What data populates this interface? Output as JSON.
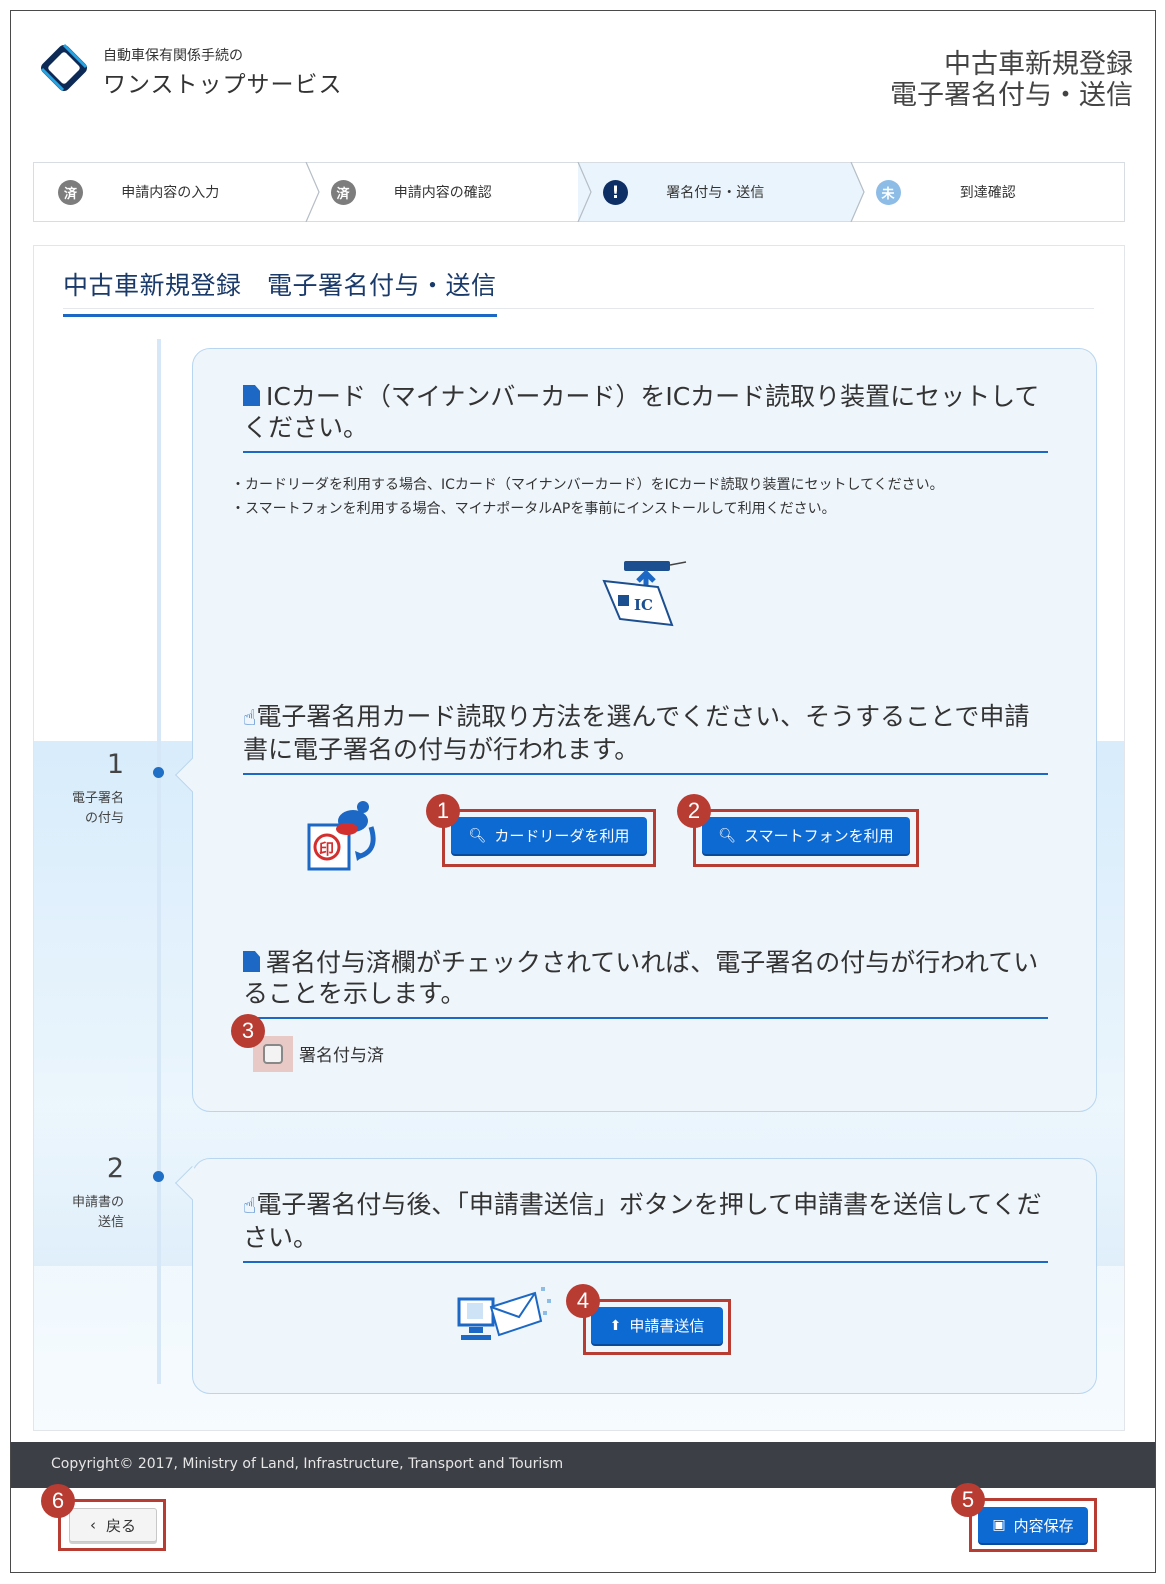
{
  "header": {
    "service_small": "自動車保有関係手続の",
    "service_big": "ワンストップサービス",
    "title_line1": "中古車新規登録",
    "title_line2": "電子署名付与・送信"
  },
  "steps": [
    {
      "icon": "済",
      "label": "申請内容の入力",
      "status": "done"
    },
    {
      "icon": "済",
      "label": "申請内容の確認",
      "status": "done"
    },
    {
      "icon": "!",
      "label": "署名付与・送信",
      "status": "current"
    },
    {
      "icon": "未",
      "label": "到達確認",
      "status": "todo"
    }
  ],
  "page_title": "中古車新規登録　電子署名付与・送信",
  "timeline": [
    {
      "num": "1",
      "sub1": "電子署名",
      "sub2": "の付与"
    },
    {
      "num": "2",
      "sub1": "申請書の",
      "sub2": "送信"
    }
  ],
  "section1": {
    "card_heading": "ICカード（マイナンバーカード）をICカード読取り装置にセットしてください。",
    "note1": "・カードリーダを利用する場合、ICカード（マイナンバーカード）をICカード読取り装置にセットしてください。",
    "note2": "・スマートフォンを利用する場合、マイナポータルAPを事前にインストールして利用ください。",
    "ic_label": "IC",
    "method_heading": "電子署名用カード読取り方法を選んでください、そうすることで申請書に電子署名の付与が行われます。",
    "stamp_label": "印",
    "btn_card_reader": "カードリーダを利用",
    "btn_smartphone": "スマートフォンを利用",
    "check_heading": "署名付与済欄がチェックされていれば、電子署名の付与が行われていることを示します。",
    "check_label": "署名付与済",
    "checked": false
  },
  "section2": {
    "heading": "電子署名付与後、「申請書送信」ボタンを押して申請書を送信してください。",
    "btn_send": "申請書送信"
  },
  "footer": {
    "copyright": "Copyright© 2017, Ministry of Land, Infrastructure, Transport and Tourism",
    "back_label": "戻る",
    "save_label": "内容保存"
  },
  "badges": [
    "1",
    "2",
    "3",
    "4",
    "5",
    "6"
  ],
  "colors": {
    "accent": "#1c68c4",
    "button": "#0d6ad3",
    "highlight": "#b93c33",
    "footer": "#3c3f45"
  }
}
